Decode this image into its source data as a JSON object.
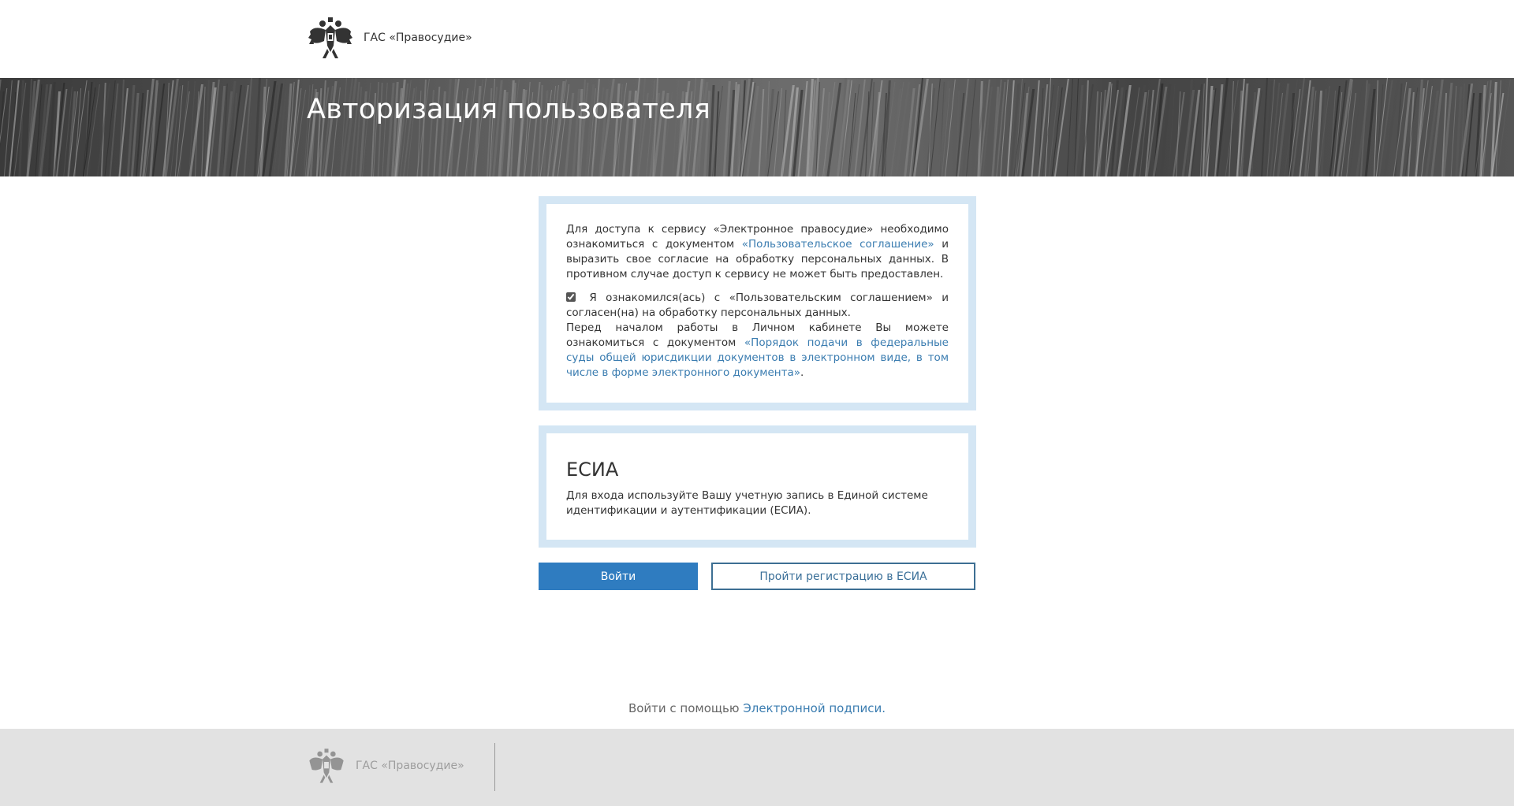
{
  "header": {
    "brand": "ГАС «Правосудие»",
    "emblem_icon": "russian-coat-of-arms-icon"
  },
  "banner": {
    "title": "Авторизация пользователя"
  },
  "agreement": {
    "text1_before": "Для доступа к сервису «Электронное правосудие» необходимо ознакомиться с документом ",
    "text1_link": "«Пользовательское соглашение»",
    "text1_after": " и выразить свое согласие на обработку персональных данных. В противном случае доступ к сервису не может быть предоставлен.",
    "checkbox_label": "Я ознакомился(ась) с «Пользовательским соглашением» и согласен(на) на обработку персональных данных.",
    "checkbox_checked": true,
    "text2_before": "Перед началом работы в Личном кабинете Вы можете ознакомиться с документом ",
    "text2_link": "«Порядок подачи в федеральные суды общей юрисдикции документов в электронном виде, в том числе в форме электронного документа»",
    "text2_after": "."
  },
  "esia": {
    "title": "ЕСИА",
    "text": "Для входа используйте Вашу учетную запись в Единой системе идентификации и аутентификации (ЕСИА)."
  },
  "buttons": {
    "login": "Войти",
    "register": "Пройти регистрацию в ЕСИА"
  },
  "signature": {
    "before": "Войти с помощью ",
    "link": "Электронной подписи."
  },
  "footer": {
    "brand": "ГАС «Правосудие»"
  },
  "colors": {
    "accent": "#2f7cc0",
    "card_border": "#d4e6f4",
    "link": "#3a7cb0",
    "footer_bg": "#e2e2e2"
  }
}
